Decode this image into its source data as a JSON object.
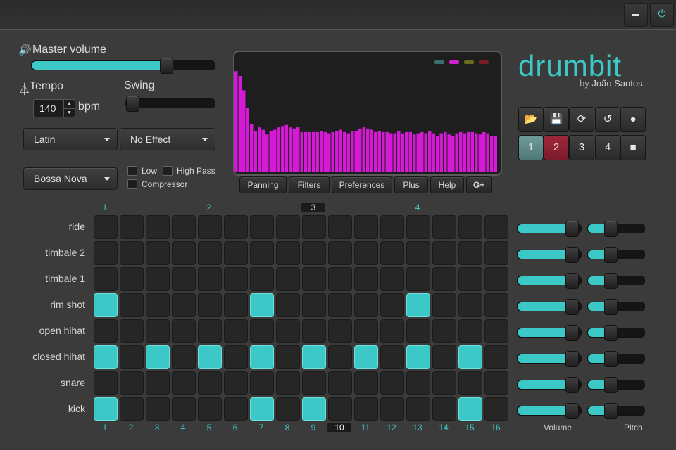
{
  "window": {
    "minimize": "minimize-button",
    "power": "power-icon"
  },
  "master": {
    "label": "Master volume",
    "value": 0.73
  },
  "tempo": {
    "label": "Tempo",
    "value": "140",
    "unit": "bpm"
  },
  "swing": {
    "label": "Swing",
    "value": 0.0
  },
  "genre": {
    "selected": "Latin"
  },
  "effect": {
    "selected": "No Effect"
  },
  "pattern": {
    "selected": "Bossa Nova"
  },
  "filters": [
    {
      "label": "Low",
      "checked": false
    },
    {
      "label": "High Pass",
      "checked": false
    },
    {
      "label": "Compressor",
      "checked": false
    }
  ],
  "visualizer": {
    "legend_colors": [
      "#3a6e6f",
      "#d020d0",
      "#6b6b22",
      "#7a1c24"
    ],
    "bar_color": "#d41ad4",
    "levels": [
      0.84,
      0.8,
      0.68,
      0.53,
      0.4,
      0.34,
      0.37,
      0.35,
      0.31,
      0.34,
      0.35,
      0.37,
      0.38,
      0.39,
      0.37,
      0.36,
      0.37,
      0.33,
      0.33,
      0.33,
      0.33,
      0.33,
      0.34,
      0.33,
      0.32,
      0.33,
      0.34,
      0.35,
      0.33,
      0.32,
      0.34,
      0.34,
      0.36,
      0.37,
      0.36,
      0.35,
      0.33,
      0.34,
      0.33,
      0.33,
      0.32,
      0.32,
      0.34,
      0.32,
      0.33,
      0.33,
      0.31,
      0.32,
      0.33,
      0.32,
      0.34,
      0.32,
      0.3,
      0.32,
      0.33,
      0.31,
      0.3,
      0.32,
      0.33,
      0.32,
      0.33,
      0.33,
      0.32,
      0.31,
      0.33,
      0.32,
      0.3,
      0.3
    ]
  },
  "tabs": [
    "Panning",
    "Filters",
    "Preferences",
    "Plus",
    "Help",
    "G+"
  ],
  "brand": {
    "name": "drumbit",
    "by": "by",
    "author": "João Santos"
  },
  "toolbar": {
    "icons": [
      "open-folder-icon",
      "save-icon",
      "refresh-icon",
      "undo-icon",
      "record-icon",
      "stop-icon"
    ],
    "patterns": [
      "1",
      "2",
      "3",
      "4"
    ]
  },
  "beats": [
    "1",
    "2",
    "3",
    "4"
  ],
  "active_beat": "3",
  "steps": [
    "1",
    "2",
    "3",
    "4",
    "5",
    "6",
    "7",
    "8",
    "9",
    "10",
    "11",
    "12",
    "13",
    "14",
    "15",
    "16"
  ],
  "current_step": "10",
  "instruments": [
    {
      "name": "ride",
      "steps": [],
      "volume": 0.85,
      "pitch": 0.4
    },
    {
      "name": "timbale 2",
      "steps": [],
      "volume": 0.85,
      "pitch": 0.4
    },
    {
      "name": "timbale 1",
      "steps": [],
      "volume": 0.85,
      "pitch": 0.4
    },
    {
      "name": "rim shot",
      "steps": [
        1,
        7,
        13
      ],
      "volume": 0.85,
      "pitch": 0.4
    },
    {
      "name": "open hihat",
      "steps": [],
      "volume": 0.85,
      "pitch": 0.4
    },
    {
      "name": "closed hihat",
      "steps": [
        1,
        3,
        5,
        7,
        9,
        11,
        13,
        15
      ],
      "volume": 0.85,
      "pitch": 0.4
    },
    {
      "name": "snare",
      "steps": [],
      "volume": 0.85,
      "pitch": 0.4
    },
    {
      "name": "kick",
      "steps": [
        1,
        7,
        9,
        15
      ],
      "volume": 0.85,
      "pitch": 0.4
    }
  ],
  "footer": {
    "volume": "Volume",
    "pitch": "Pitch"
  }
}
